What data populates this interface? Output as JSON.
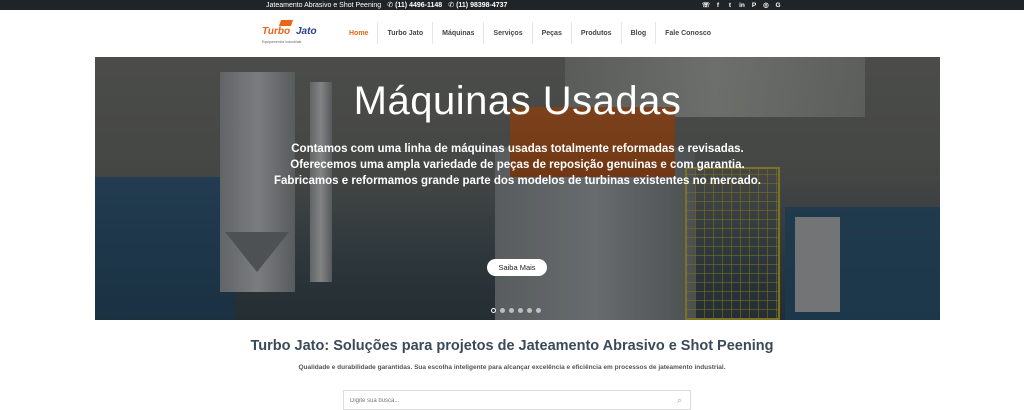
{
  "topbar": {
    "tagline": "Jateamento Abrasivo e Shot Peening",
    "phone1": "(11) 4496-1148",
    "phone2": "(11) 98398-4737",
    "social_icons": [
      "whatsapp-icon",
      "facebook-icon",
      "twitter-icon",
      "linkedin-icon",
      "pinterest-icon",
      "instagram-icon",
      "google-icon"
    ],
    "social_glyphs": [
      "☏",
      "f",
      "t",
      "in",
      "P",
      "◎",
      "G"
    ]
  },
  "logo": {
    "turbo": "Turbo",
    "jato": "Jato",
    "tagline": "Equipamentos Industriais"
  },
  "nav": {
    "items": [
      {
        "label": "Home",
        "active": true
      },
      {
        "label": "Turbo Jato"
      },
      {
        "label": "Máquinas"
      },
      {
        "label": "Serviços"
      },
      {
        "label": "Peças"
      },
      {
        "label": "Produtos"
      },
      {
        "label": "Blog"
      },
      {
        "label": "Fale Conosco"
      }
    ]
  },
  "hero": {
    "title": "Máquinas Usadas",
    "description": "Contamos com uma linha de máquinas usadas totalmente reformadas e revisadas. Oferecemos uma ampla variedade de peças de reposição genuinas e com garantia. Fabricamos e reformamos grande parte dos modelos de turbinas existentes no mercado.",
    "cta_label": "Saiba Mais",
    "slide_count": 6,
    "active_slide": 1
  },
  "main": {
    "headline": "Turbo Jato: Soluções para projetos de Jateamento Abrasivo e Shot Peening",
    "subline": "Qualidade e durabilidade garantidas. Sua escolha inteligente para alcançar excelência e eficiência em processos de jateamento industrial.",
    "search_placeholder": "Digite sua busca..."
  },
  "colors": {
    "accent": "#e8651a",
    "brand_blue": "#2a3f8a",
    "topbar_bg": "#1f2428"
  }
}
